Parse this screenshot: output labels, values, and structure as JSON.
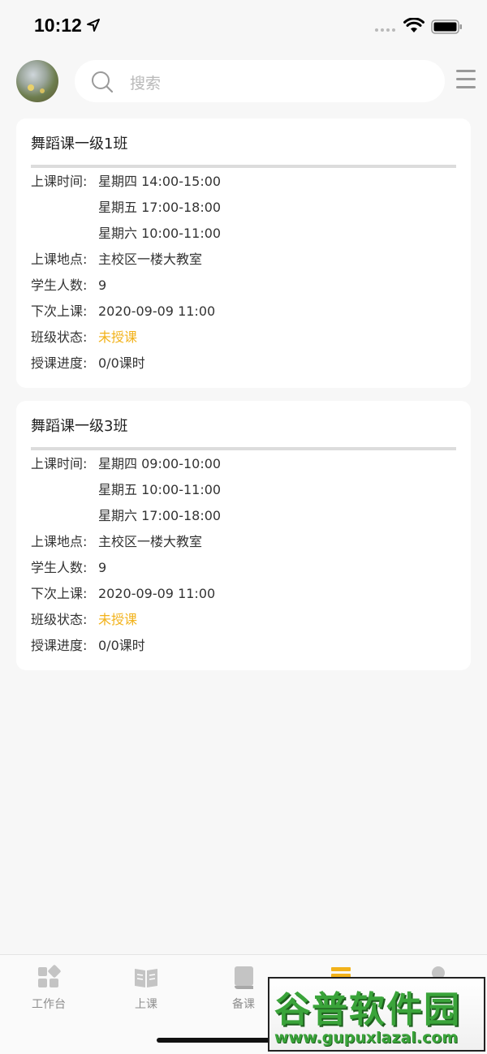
{
  "status_bar": {
    "time": "10:12"
  },
  "search": {
    "placeholder": "搜索"
  },
  "cards": [
    {
      "title": "舞蹈课一级1班",
      "schedule_label": "上课时间:",
      "schedule": [
        "星期四 14:00-15:00",
        "星期五 17:00-18:00",
        "星期六 10:00-11:00"
      ],
      "location_label": "上课地点:",
      "location": "主校区一楼大教室",
      "students_label": "学生人数:",
      "students": "9",
      "next_label": "下次上课:",
      "next": "2020-09-09 11:00",
      "status_label": "班级状态:",
      "status": "未授课",
      "progress_label": "授课进度:",
      "progress": "0/0课时"
    },
    {
      "title": "舞蹈课一级3班",
      "schedule_label": "上课时间:",
      "schedule": [
        "星期四 09:00-10:00",
        "星期五 10:00-11:00",
        "星期六 17:00-18:00"
      ],
      "location_label": "上课地点:",
      "location": "主校区一楼大教室",
      "students_label": "学生人数:",
      "students": "9",
      "next_label": "下次上课:",
      "next": "2020-09-09 11:00",
      "status_label": "班级状态:",
      "status": "未授课",
      "progress_label": "授课进度:",
      "progress": "0/0课时"
    }
  ],
  "tab_bar": {
    "items": [
      {
        "label": "工作台",
        "icon": "workbench-icon"
      },
      {
        "label": "上课",
        "icon": "open-book-icon"
      },
      {
        "label": "备课",
        "icon": "book-icon"
      },
      {
        "label": "",
        "icon": "class-icon",
        "active": true
      },
      {
        "label": "",
        "icon": "profile-icon"
      }
    ]
  },
  "watermark": {
    "main": "谷普软件园",
    "sub": "www.gupuxlazal.com"
  },
  "colors": {
    "accent": "#f2b21a",
    "background": "#f7f7f7",
    "card": "#ffffff"
  }
}
